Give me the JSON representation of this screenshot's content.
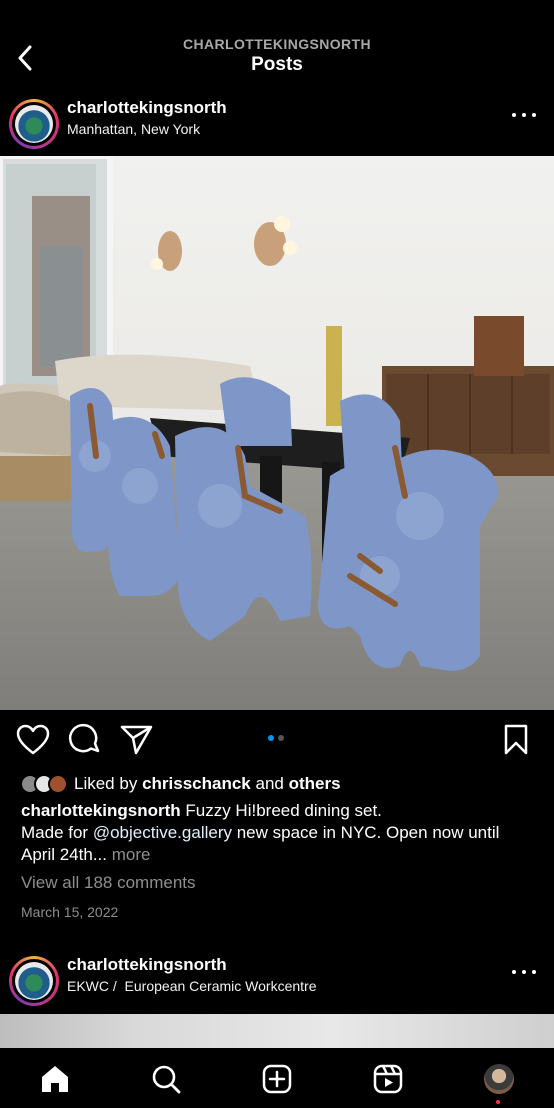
{
  "header": {
    "subtitle": "CHARLOTTEKINGSNORTH",
    "title": "Posts"
  },
  "post": {
    "username": "charlottekingsnorth",
    "location": "Manhattan, New York",
    "liked_prefix": "Liked by",
    "liked_user": "chrisschanck",
    "liked_and": "and",
    "liked_others": "others",
    "caption_title": "Fuzzy Hi!breed dining set.",
    "caption_made_for": "Made for",
    "caption_mention": "@objective.gallery",
    "caption_rest": "new space in NYC. Open now until April 24th...",
    "caption_more": "more",
    "comments_link": "View all 188 comments",
    "date": "March 15, 2022",
    "carousel_current": 1,
    "carousel_total": 2
  },
  "next_post": {
    "username": "charlottekingsnorth",
    "location": "EKWC /  European Ceramic Workcentre"
  },
  "icons": {
    "back": "chevron-left-icon",
    "more": "more-horizontal-icon",
    "like": "heart-icon",
    "comment": "comment-icon",
    "share": "paper-plane-icon",
    "save": "bookmark-icon",
    "home": "home-icon",
    "search": "search-icon",
    "create": "plus-square-icon",
    "reels": "reels-icon"
  },
  "colors": {
    "background": "#000000",
    "accent": "#0095f6",
    "muted": "#8e8e8e",
    "notification": "#ff3040"
  }
}
